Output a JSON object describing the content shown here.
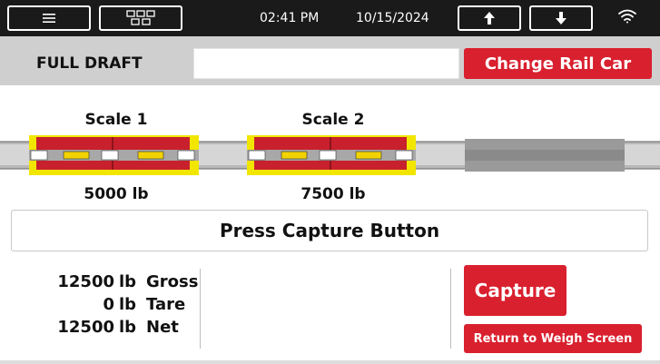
{
  "topbar": {
    "menu_icon": "hamburger-menu-icon",
    "layout_icon": "scale-layout-icon",
    "time": "02:41 PM",
    "date": "10/15/2024",
    "up_icon": "arrow-up-icon",
    "down_icon": "arrow-down-icon",
    "wifi_icon": "wifi-icon"
  },
  "header": {
    "mode": "FULL DRAFT",
    "rail_car_value": "",
    "change_rail_car_label": "Change Rail Car"
  },
  "scales": [
    {
      "label": "Scale 1",
      "weight": "5000 lb"
    },
    {
      "label": "Scale 2",
      "weight": "7500 lb"
    }
  ],
  "message": "Press Capture Button",
  "totals": [
    {
      "value": "12500",
      "unit": "lb",
      "label": "Gross"
    },
    {
      "value": "0",
      "unit": "lb",
      "label": "Tare"
    },
    {
      "value": "12500",
      "unit": "lb",
      "label": "Net"
    }
  ],
  "actions": {
    "capture_label": "Capture",
    "return_label": "Return to Weigh Screen"
  },
  "colors": {
    "accent_red": "#d9202e",
    "highlight_yellow": "#f2e600",
    "topbar_bg": "#1a1a1a",
    "header_bg": "#cfcfcf"
  }
}
